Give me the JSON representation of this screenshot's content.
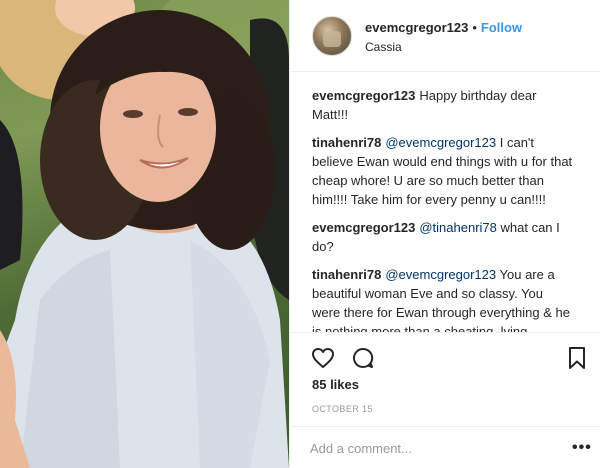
{
  "photo": {
    "alt_subject": "woman-portrait"
  },
  "header": {
    "username": "evemcgregor123",
    "separator": "•",
    "follow_label": "Follow",
    "location": "Cassia"
  },
  "comments": [
    {
      "user": "evemcgregor123",
      "mention": "",
      "text": "Happy birthday dear Matt!!!"
    },
    {
      "user": "tinahenri78",
      "mention": "@evemcgregor123",
      "text": "I can't believe Ewan would end things with u for that cheap whore! U are so much better than him!!!! Take him for every penny u can!!!!"
    },
    {
      "user": "evemcgregor123",
      "mention": "@tinahenri78",
      "text": "what can I do?"
    },
    {
      "user": "tinahenri78",
      "mention": "@evemcgregor123",
      "text": "You are a beautiful woman Eve and so classy. You were there for Ewan through everything & he is nothing more than a cheating, lying"
    }
  ],
  "actions": {
    "icons": [
      "heart-icon",
      "comment-icon",
      "bookmark-icon"
    ]
  },
  "likes_label": "85 likes",
  "date_label": "OCTOBER 15",
  "comment_box": {
    "placeholder": "Add a comment...",
    "more_label": "•••"
  },
  "colors": {
    "accent": "#3897f0",
    "mention": "#003569",
    "muted": "#999999",
    "text": "#262626",
    "border": "#efefef"
  }
}
